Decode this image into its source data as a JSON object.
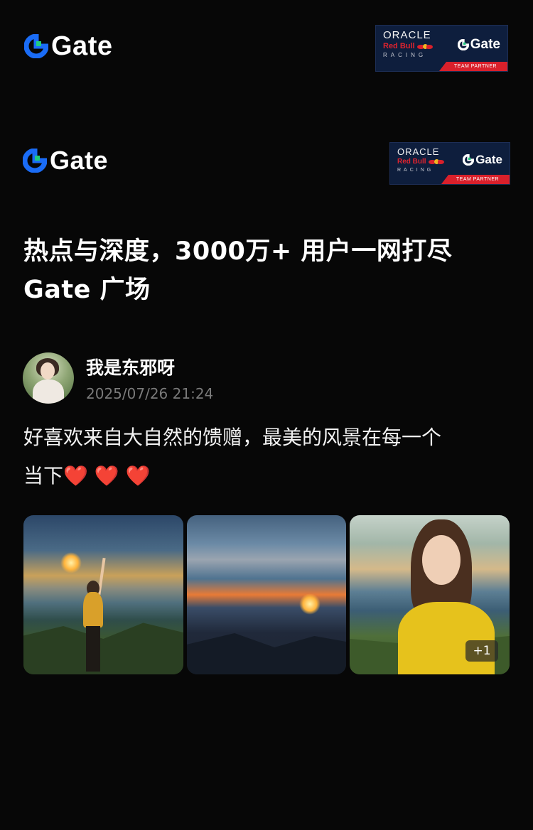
{
  "brand": {
    "name": "Gate",
    "colors": {
      "accent_blue": "#1a6cf6",
      "accent_green": "#1fcc7f",
      "badge_bg": "#0e1e3d",
      "badge_red": "#d9202b"
    }
  },
  "partner_badge": {
    "oracle": "ORACLE",
    "redbull": "Red Bull",
    "racing": "RACING",
    "gate": "Gate",
    "strip": "TEAM PARTNER"
  },
  "headline": {
    "line1": "热点与深度，3000万+ 用户一网打尽",
    "line2": "Gate 广场"
  },
  "post": {
    "username": "我是东邪呀",
    "timestamp": "2025/07/26 21:24",
    "text_line1": "好喜欢来自大自然的馈赠，最美的风景在每一个",
    "text_line2": "当下",
    "hearts": "❤️ ❤️ ❤️",
    "more_count": "+1"
  }
}
